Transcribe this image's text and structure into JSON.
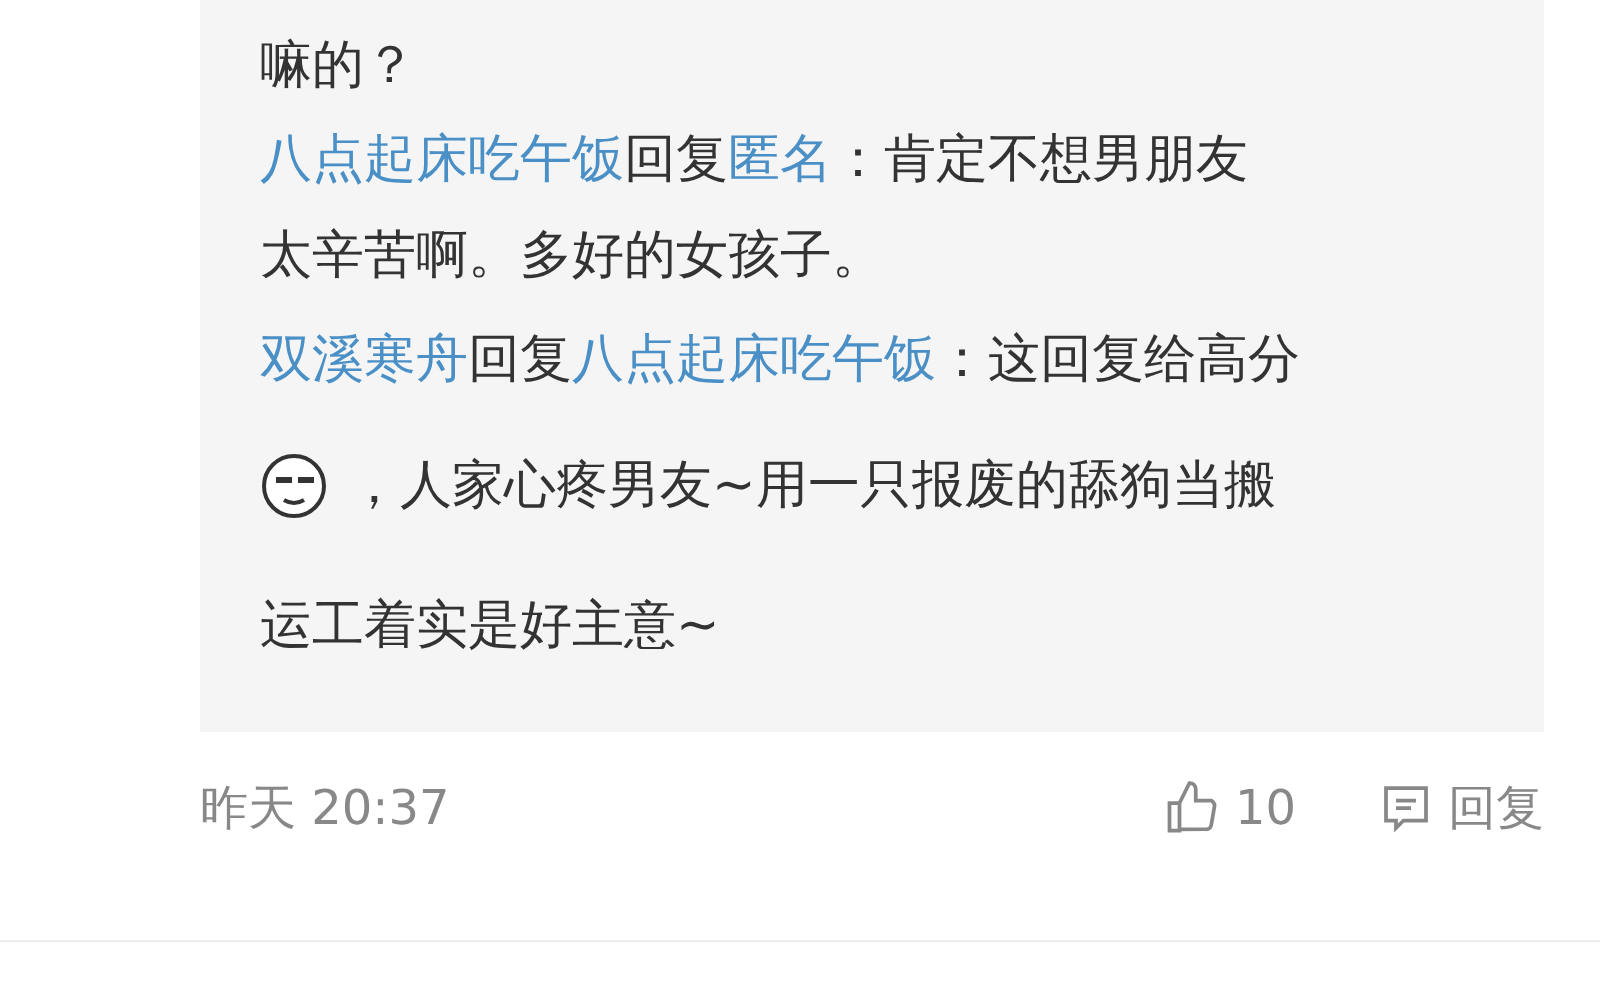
{
  "thread": {
    "lead_tail": "嘛的？",
    "replies": [
      {
        "author": "八点起床吃午饭",
        "reply_word": "回复",
        "target": "匿名",
        "colon": "：",
        "lines": [
          {
            "kind": "text",
            "text": "肯定不想男朋友"
          },
          {
            "kind": "text",
            "text": "太辛苦啊。多好的女孩子。"
          }
        ]
      },
      {
        "author": "双溪寒舟",
        "reply_word": "回复",
        "target": "八点起床吃午饭",
        "colon": "：",
        "lines": [
          {
            "kind": "text",
            "text": "这回复给高分"
          },
          {
            "kind": "emoji_text",
            "text": "，人家心疼男友~用一只报废的舔狗当搬"
          },
          {
            "kind": "text",
            "text": "运工着实是好主意~"
          }
        ]
      }
    ]
  },
  "footer": {
    "time": "昨天 20:37",
    "likes": "10",
    "reply_label": "回复"
  }
}
